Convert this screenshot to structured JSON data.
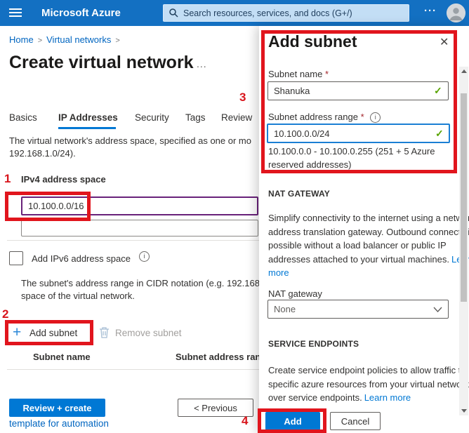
{
  "topbar": {
    "brand": "Microsoft Azure",
    "search_placeholder": "Search resources, services, and docs (G+/)",
    "more": "···"
  },
  "breadcrumb": {
    "home": "Home",
    "sep1": ">",
    "current": "Virtual networks",
    "sep2": ">"
  },
  "page": {
    "title": "Create virtual network",
    "more": "...",
    "tabs": [
      {
        "label": "Basics"
      },
      {
        "label": "IP Addresses"
      },
      {
        "label": "Security"
      },
      {
        "label": "Tags"
      },
      {
        "label": "Review"
      }
    ],
    "intro_line1": "The virtual network's address space, specified as one or mo",
    "intro_line2": "192.168.1.0/24).",
    "ipv4_label": "IPv4 address space",
    "ipv4_value": "10.100.0.0/16",
    "ipv6_label": "Add IPv6 address space",
    "note_line1": "The subnet's address range in CIDR notation (e.g. 192.168",
    "note_line2": "space of the virtual network.",
    "add_subnet": "Add subnet",
    "remove_subnet": "Remove subnet",
    "table_col1": "Subnet name",
    "table_col2": "Subnet address ran",
    "review_create": "Review + create",
    "template_link": "template for automation",
    "previous": "< Previous"
  },
  "panel": {
    "title": "Add subnet",
    "name_label": "Subnet name",
    "name_required": "*",
    "name_value": "Shanuka",
    "range_label": "Subnet address range",
    "range_required": "*",
    "range_value": "10.100.0.0/24",
    "range_helper_line1": "10.100.0.0 - 10.100.0.255 (251 + 5 Azure",
    "range_helper_line2": "reserved addresses)",
    "nat_header": "NAT GATEWAY",
    "nat_desc": "Simplify connectivity to the internet using a network address translation gateway. Outbound connectivity is possible without a load balancer or public IP addresses attached to your virtual machines.",
    "nat_learn_more": "Learn more",
    "nat_label": "NAT gateway",
    "nat_value": "None",
    "se_header": "SERVICE ENDPOINTS",
    "se_desc": "Create service endpoint policies to allow traffic to specific azure resources from your virtual network over service endpoints.",
    "se_learn_more": "Learn more",
    "add": "Add",
    "cancel": "Cancel"
  },
  "annotations": {
    "n1": "1",
    "n2": "2",
    "n3": "3",
    "n4": "4",
    "color": "#e1151d"
  },
  "icons": {
    "close": "✕",
    "check": "✓",
    "plus": "+",
    "info": "i"
  },
  "colors": {
    "accent": "#0078d4",
    "topbar": "#1370c2",
    "valid": "#57a300",
    "focus": "#1b7fd4",
    "modified_border": "#68217a"
  }
}
